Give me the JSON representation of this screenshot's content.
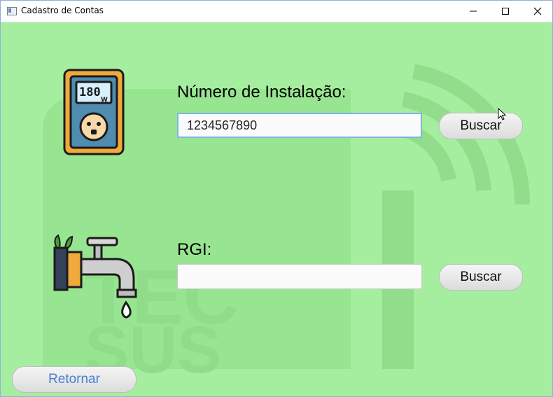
{
  "window": {
    "title": "Cadastro de Contas"
  },
  "controls": {
    "minimize_icon": "minimize-icon",
    "maximize_icon": "maximize-icon",
    "close_icon": "close-icon"
  },
  "installation": {
    "label": "Número de Instalação:",
    "value": "1234567890",
    "search_label": "Buscar",
    "icon": "energy-meter-icon",
    "meter_display": "180",
    "meter_unit": "W"
  },
  "rgi": {
    "label": "RGI:",
    "value": "",
    "search_label": "Buscar",
    "icon": "water-faucet-icon"
  },
  "return_label": "Retornar",
  "watermark": {
    "line1": "TEC",
    "line2": "SUS"
  },
  "colors": {
    "background": "#a6ee9f",
    "watermark": "#8fdc8a",
    "return_text": "#4a7fd0",
    "focus_border": "#7cb6e0"
  }
}
